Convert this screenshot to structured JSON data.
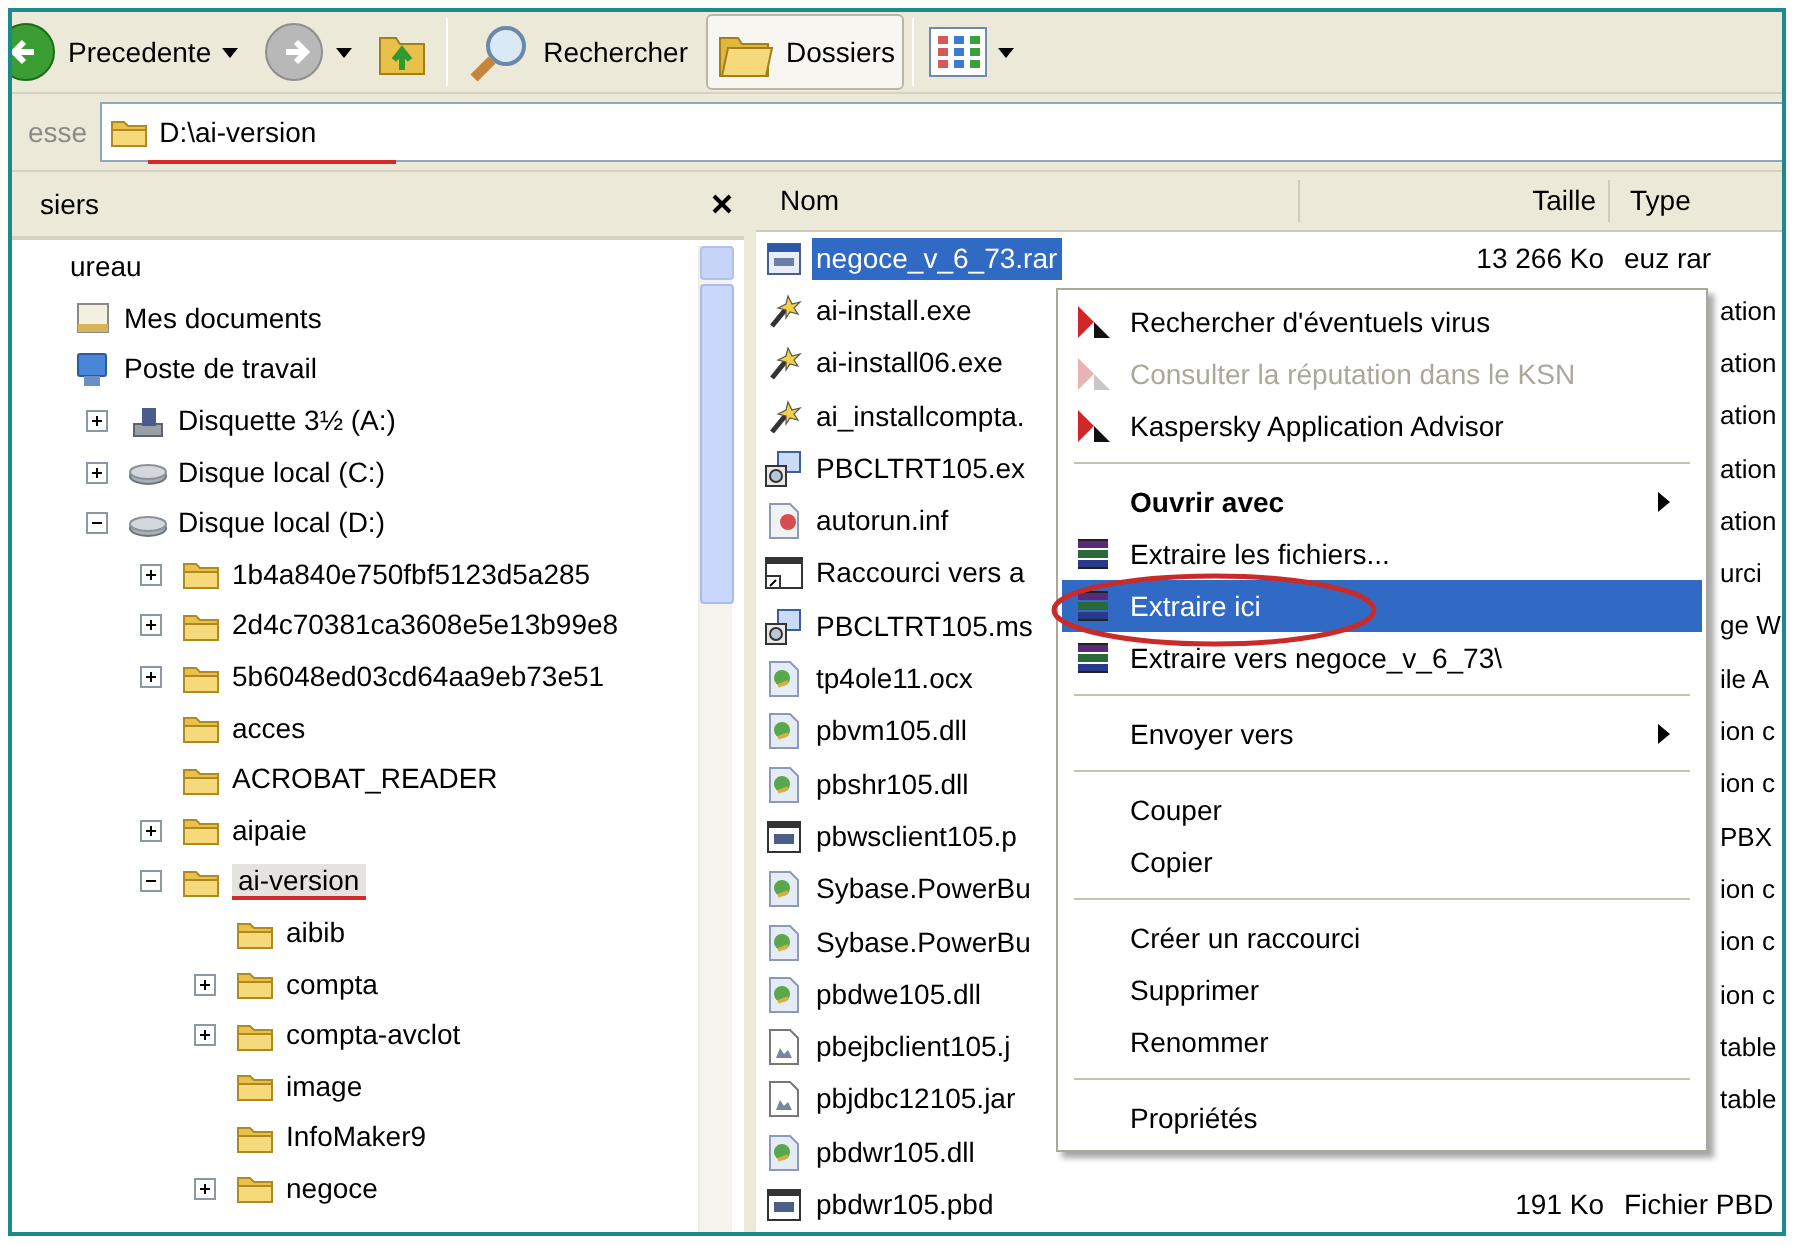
{
  "toolbar": {
    "buttons": [
      {
        "kind": "back",
        "label": "Precedente",
        "dropdown": true,
        "disabled": false,
        "selected": false
      },
      {
        "kind": "forward",
        "dropdown": true,
        "disabled": true,
        "selected": false
      },
      {
        "kind": "up",
        "dropdown": false,
        "selected": false
      },
      {
        "kind": "separator"
      },
      {
        "kind": "search",
        "label": "Rechercher",
        "dropdown": false,
        "selected": false
      },
      {
        "kind": "folders",
        "label": "Dossiers",
        "dropdown": false,
        "selected": true
      },
      {
        "kind": "separator"
      },
      {
        "kind": "views",
        "dropdown": true,
        "selected": false
      }
    ]
  },
  "address_bar": {
    "label": "esse",
    "value": "D:\\ai-version",
    "underlined": true
  },
  "folders_pane": {
    "title": "siers",
    "tree": [
      {
        "label": "ureau",
        "selected": false,
        "underlined": false,
        "children": [
          {
            "label": "Mes documents",
            "kind": "documents",
            "selected": false,
            "underlined": false
          },
          {
            "label": "Poste de travail",
            "kind": "computer",
            "selected": false,
            "underlined": false,
            "children": [
              {
                "label": "Disquette 3½ (A:)",
                "kind": "floppy",
                "expanded": false,
                "selected": false,
                "underlined": false
              },
              {
                "label": "Disque local (C:)",
                "kind": "drive",
                "expanded": false,
                "selected": false,
                "underlined": false
              },
              {
                "label": "Disque local (D:)",
                "kind": "drive",
                "expanded": true,
                "selected": false,
                "underlined": false,
                "children": [
                  {
                    "label": "1b4a840e750fbf5123d5a285",
                    "kind": "folder",
                    "expanded": false,
                    "selected": false,
                    "underlined": false
                  },
                  {
                    "label": "2d4c70381ca3608e5e13b99e8",
                    "kind": "folder",
                    "expanded": false,
                    "selected": false,
                    "underlined": false
                  },
                  {
                    "label": "5b6048ed03cd64aa9eb73e51",
                    "kind": "folder",
                    "expanded": false,
                    "selected": false,
                    "underlined": false
                  },
                  {
                    "label": "acces",
                    "kind": "folder",
                    "selected": false,
                    "underlined": false
                  },
                  {
                    "label": "ACROBAT_READER",
                    "kind": "folder",
                    "selected": false,
                    "underlined": false
                  },
                  {
                    "label": "aipaie",
                    "kind": "folder",
                    "expanded": false,
                    "selected": false,
                    "underlined": false
                  },
                  {
                    "label": "ai-version",
                    "kind": "folder",
                    "expanded": true,
                    "selected": true,
                    "underlined": true,
                    "children": [
                      {
                        "label": "aibib",
                        "kind": "folder",
                        "selected": false,
                        "underlined": false
                      },
                      {
                        "label": "compta",
                        "kind": "folder",
                        "expanded": false,
                        "selected": false,
                        "underlined": false
                      },
                      {
                        "label": "compta-avclot",
                        "kind": "folder",
                        "expanded": false,
                        "selected": false,
                        "underlined": false
                      },
                      {
                        "label": "image",
                        "kind": "folder",
                        "selected": false,
                        "underlined": false
                      },
                      {
                        "label": "InfoMaker9",
                        "kind": "folder",
                        "selected": false,
                        "underlined": false
                      },
                      {
                        "label": "negoce",
                        "kind": "folder",
                        "expanded": false,
                        "selected": false,
                        "underlined": false
                      }
                    ]
                  }
                ]
              }
            ]
          }
        ]
      }
    ]
  },
  "file_list": {
    "columns": [
      {
        "label": "Nom"
      },
      {
        "label": "Taille"
      },
      {
        "label": "Type"
      }
    ],
    "rows": [
      {
        "name": "negoce_v_6_73.rar",
        "kind": "archive",
        "selected": true,
        "covered": false,
        "size": "13 266 Ko",
        "type": "euz rar"
      },
      {
        "name": "ai-install.exe",
        "kind": "installer",
        "selected": false,
        "covered": true,
        "type": "ation"
      },
      {
        "name": "ai-install06.exe",
        "kind": "installer",
        "selected": false,
        "covered": true,
        "type": "ation"
      },
      {
        "name": "ai_installcompta.",
        "kind": "installer",
        "selected": false,
        "covered": true,
        "type": "ation"
      },
      {
        "name": "PBCLTRT105.ex",
        "kind": "setup",
        "selected": false,
        "covered": true,
        "type": "ation"
      },
      {
        "name": "autorun.inf",
        "kind": "ini",
        "selected": false,
        "covered": true,
        "type": "ation"
      },
      {
        "name": "Raccourci vers a",
        "kind": "shortcut",
        "selected": false,
        "covered": true,
        "type": "urci"
      },
      {
        "name": "PBCLTRT105.ms",
        "kind": "setup",
        "selected": false,
        "covered": true,
        "type": "ge W"
      },
      {
        "name": "tp4ole11.ocx",
        "kind": "dll",
        "selected": false,
        "covered": true,
        "type": "ile A"
      },
      {
        "name": "pbvm105.dll",
        "kind": "dll",
        "selected": false,
        "covered": true,
        "type": "ion c"
      },
      {
        "name": "pbshr105.dll",
        "kind": "dll",
        "selected": false,
        "covered": true,
        "type": "ion c"
      },
      {
        "name": "pbwsclient105.p",
        "kind": "window",
        "selected": false,
        "covered": true,
        "type": "PBX"
      },
      {
        "name": "Sybase.PowerBu",
        "kind": "dll",
        "selected": false,
        "covered": true,
        "type": "ion c"
      },
      {
        "name": "Sybase.PowerBu",
        "kind": "dll",
        "selected": false,
        "covered": true,
        "type": "ion c"
      },
      {
        "name": "pbdwe105.dll",
        "kind": "dll",
        "selected": false,
        "covered": true,
        "type": "ion c"
      },
      {
        "name": "pbejbclient105.j",
        "kind": "jar",
        "selected": false,
        "covered": true,
        "type": "table"
      },
      {
        "name": "pbjdbc12105.jar",
        "kind": "jar",
        "selected": false,
        "covered": true,
        "type": "table"
      },
      {
        "name": "pbdwr105.dll",
        "kind": "dll",
        "selected": false
      },
      {
        "name": "pbdwr105.pbd",
        "kind": "window",
        "selected": false,
        "covered": false,
        "size": "191 Ko",
        "type": "Fichier PBD"
      }
    ]
  },
  "context_menu": {
    "items": [
      {
        "kind": "antivirus",
        "label": "Rechercher d'éventuels virus",
        "bold": false,
        "disabled": false,
        "submenu": false,
        "selected": false,
        "circled": false
      },
      {
        "kind": "antivirus",
        "label": "Consulter la réputation dans le KSN",
        "bold": false,
        "disabled": true,
        "submenu": false,
        "selected": false,
        "circled": false
      },
      {
        "kind": "antivirus",
        "label": "Kaspersky Application Advisor",
        "bold": false,
        "disabled": false,
        "submenu": false,
        "selected": false,
        "circled": false
      },
      {
        "kind": "separator"
      },
      {
        "kind": "plain",
        "label": "Ouvrir avec",
        "bold": true,
        "disabled": false,
        "submenu": true,
        "selected": false,
        "circled": false
      },
      {
        "kind": "archiver",
        "label": "Extraire les fichiers...",
        "bold": false,
        "disabled": false,
        "submenu": false,
        "selected": false,
        "circled": false
      },
      {
        "kind": "archiver",
        "label": "Extraire ici",
        "bold": false,
        "disabled": false,
        "submenu": false,
        "selected": true,
        "circled": true
      },
      {
        "kind": "archiver",
        "label": "Extraire vers negoce_v_6_73\\",
        "bold": false,
        "disabled": false,
        "submenu": false,
        "selected": false,
        "circled": false
      },
      {
        "kind": "separator"
      },
      {
        "kind": "plain",
        "label": "Envoyer vers",
        "bold": false,
        "disabled": false,
        "submenu": true,
        "selected": false,
        "circled": false
      },
      {
        "kind": "separator"
      },
      {
        "kind": "plain",
        "label": "Couper",
        "bold": false,
        "disabled": false,
        "submenu": false,
        "selected": false,
        "circled": false
      },
      {
        "kind": "plain",
        "label": "Copier",
        "bold": false,
        "disabled": false,
        "submenu": false,
        "selected": false,
        "circled": false
      },
      {
        "kind": "separator"
      },
      {
        "kind": "plain",
        "label": "Créer un raccourci",
        "bold": false,
        "disabled": false,
        "submenu": false,
        "selected": false,
        "circled": false
      },
      {
        "kind": "plain",
        "label": "Supprimer",
        "bold": false,
        "disabled": false,
        "submenu": false,
        "selected": false,
        "circled": false
      },
      {
        "kind": "plain",
        "label": "Renommer",
        "bold": false,
        "disabled": false,
        "submenu": false,
        "selected": false,
        "circled": false
      },
      {
        "kind": "separator"
      },
      {
        "kind": "plain",
        "label": "Propriétés",
        "bold": false,
        "disabled": false,
        "submenu": false,
        "selected": false,
        "circled": false
      }
    ]
  }
}
